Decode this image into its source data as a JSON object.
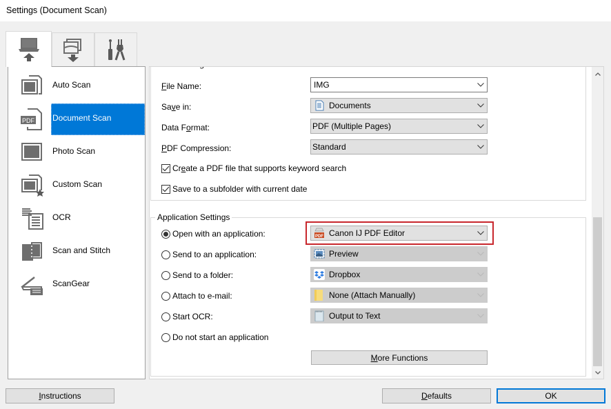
{
  "window": {
    "title": "Settings (Document Scan)"
  },
  "tabs": [
    {
      "name": "scan-from-computer",
      "icon": "computer-upload-icon",
      "active": true
    },
    {
      "name": "scan-from-panel",
      "icon": "scanner-download-icon",
      "active": false
    },
    {
      "name": "general-settings",
      "icon": "tools-icon",
      "active": false
    }
  ],
  "sidebar": {
    "items": [
      {
        "label": "Auto Scan",
        "icon": "auto-scan-icon",
        "active": false
      },
      {
        "label": "Document Scan",
        "icon": "pdf-document-icon",
        "active": true
      },
      {
        "label": "Photo Scan",
        "icon": "photo-scan-icon",
        "active": false
      },
      {
        "label": "Custom Scan",
        "icon": "custom-scan-icon",
        "active": false
      },
      {
        "label": "OCR",
        "icon": "ocr-icon",
        "active": false
      },
      {
        "label": "Scan and Stitch",
        "icon": "scan-stitch-icon",
        "active": false
      },
      {
        "label": "ScanGear",
        "icon": "scangear-icon",
        "active": false
      }
    ]
  },
  "save_settings": {
    "legend": "Save Settings",
    "file_name": {
      "label_u": "F",
      "label_rest": "ile Name:",
      "value": "IMG"
    },
    "save_in": {
      "label_pre": "Sa",
      "label_u": "v",
      "label_rest": "e in:",
      "value": "Documents",
      "icon": "documents-folder-icon"
    },
    "data_format": {
      "label_pre": "Data F",
      "label_u": "o",
      "label_rest": "rmat:",
      "value": "PDF (Multiple Pages)"
    },
    "pdf_compression": {
      "label_u": "P",
      "label_rest": "DF Compression:",
      "value": "Standard"
    },
    "keyword_search": {
      "label_pre": "Cr",
      "label_u": "e",
      "label_rest": "ate a PDF file that supports keyword search",
      "checked": true
    },
    "subfolder_date": {
      "label": "Save to a subfolder with current date",
      "checked": true
    }
  },
  "app_settings": {
    "legend": "Application Settings",
    "options": [
      {
        "label": "Open with an application:",
        "selected": true,
        "combo_value": "Canon IJ PDF Editor",
        "combo_icon": "canon-pdf-editor-icon",
        "enabled": true
      },
      {
        "label": "Send to an application:",
        "selected": false,
        "combo_value": "Preview",
        "combo_icon": "preview-icon",
        "enabled": false
      },
      {
        "label": "Send to a folder:",
        "selected": false,
        "combo_value": "Dropbox",
        "combo_icon": "dropbox-icon",
        "enabled": false
      },
      {
        "label": "Attach to e-mail:",
        "selected": false,
        "combo_value": "None (Attach Manually)",
        "combo_icon": "folder-icon",
        "enabled": false
      },
      {
        "label": "Start OCR:",
        "selected": false,
        "combo_value": "Output to Text",
        "combo_icon": "notepad-icon",
        "enabled": false
      },
      {
        "label": "Do not start an application",
        "selected": false
      }
    ],
    "more_functions": {
      "label_u": "M",
      "label_rest": "ore Functions"
    }
  },
  "footer": {
    "instructions": {
      "label_u": "I",
      "label_rest": "nstructions"
    },
    "defaults": {
      "label_u": "D",
      "label_rest": "efaults"
    },
    "ok": {
      "label": "OK"
    }
  },
  "scroll": {
    "position_fraction": 1.0
  },
  "colors": {
    "accent": "#0078d7",
    "highlight_border": "#c8262c"
  }
}
